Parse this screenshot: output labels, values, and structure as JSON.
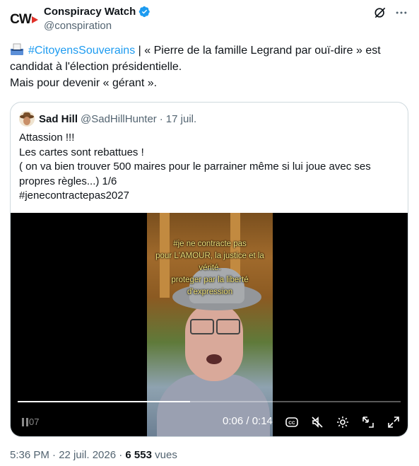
{
  "account": {
    "display_name": "Conspiracy Watch",
    "handle": "@conspiration",
    "avatar_text": "CW"
  },
  "tweet": {
    "hashtag": "#CitoyensSouverains",
    "text_after_hashtag": " | « Pierre de la famille Legrand par ouï-dire » est candidat à l'élection présidentielle.",
    "line2": "Mais pour devenir « gérant »."
  },
  "quote": {
    "display_name": "Sad Hill",
    "handle": "@SadHillHunter",
    "separator": "·",
    "date": "17 juil.",
    "lines": [
      "Attassion !!!",
      "Les cartes sont rebattues !",
      "( on va bien trouver 500 maires pour le parrainer même si lui joue avec ses",
      "propres règles...) 1/6",
      "#jenecontractepas2027"
    ]
  },
  "video": {
    "overlay_lines": [
      "#je ne contracte pas",
      "pour L'AMOUR, la justice et la",
      "vérité.",
      "proteger par la liberté",
      "d'expression"
    ],
    "current_time_partial": "07",
    "time_display": "0:06 / 0:14",
    "progress": 0.45
  },
  "footer": {
    "timestamp": "5:36 PM · 22 juil. 2026 · ",
    "views_count": "6 553",
    "views_label": " vues"
  },
  "colors": {
    "link": "#1d9bf0",
    "verified": "#1d9bf0",
    "secondary_text": "#536471"
  }
}
